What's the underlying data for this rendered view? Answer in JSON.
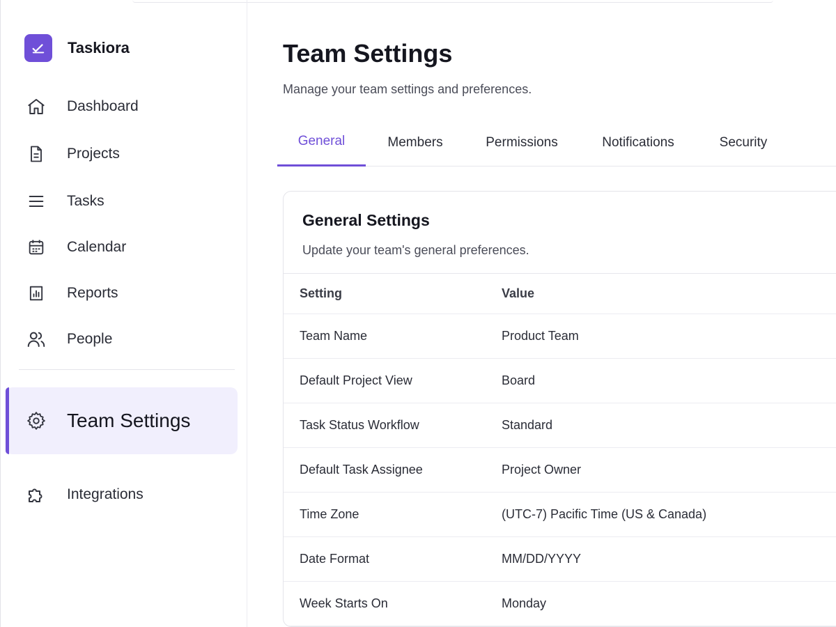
{
  "app": {
    "name": "Taskiora",
    "brand_color": "#6f4fd8"
  },
  "sidebar": {
    "items": [
      {
        "label": "Dashboard",
        "icon": "home-icon"
      },
      {
        "label": "Projects",
        "icon": "document-icon"
      },
      {
        "label": "Tasks",
        "icon": "list-icon"
      },
      {
        "label": "Calendar",
        "icon": "calendar-icon"
      },
      {
        "label": "Reports",
        "icon": "chart-icon"
      },
      {
        "label": "People",
        "icon": "users-icon"
      }
    ],
    "active": {
      "label": "Team Settings",
      "icon": "gear-icon"
    },
    "extra": {
      "label": "Integrations",
      "icon": "puzzle-icon"
    }
  },
  "page": {
    "title": "Team Settings",
    "subtitle": "Manage your team settings and preferences."
  },
  "tabs": [
    {
      "label": "General",
      "active": true
    },
    {
      "label": "Members",
      "active": false
    },
    {
      "label": "Permissions",
      "active": false
    },
    {
      "label": "Notifications",
      "active": false
    },
    {
      "label": "Security",
      "active": false
    }
  ],
  "card": {
    "title": "General Settings",
    "subtitle": "Update your team's general preferences.",
    "columns": {
      "key": "Setting",
      "value": "Value"
    },
    "rows": [
      {
        "key": "Team Name",
        "value": "Product Team"
      },
      {
        "key": "Default Project View",
        "value": "Board"
      },
      {
        "key": "Task Status Workflow",
        "value": "Standard"
      },
      {
        "key": "Default Task Assignee",
        "value": "Project Owner"
      },
      {
        "key": "Time Zone",
        "value": "(UTC-7) Pacific Time (US & Canada)"
      },
      {
        "key": "Date Format",
        "value": "MM/DD/YYYY"
      },
      {
        "key": "Week Starts On",
        "value": "Monday"
      }
    ]
  }
}
